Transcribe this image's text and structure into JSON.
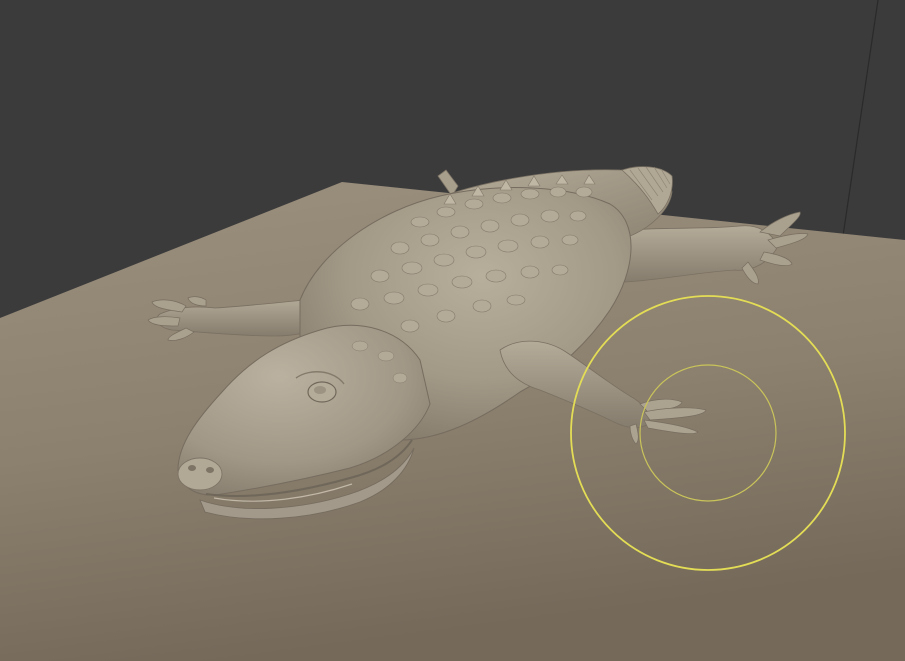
{
  "viewport": {
    "background_color": "#3a3a3a",
    "floor_color": "#8f8270",
    "floor_shadow_color": "#7b705f",
    "model_color": "#a59b89",
    "model_light_color": "#bdb3a1",
    "model_dark_color": "#766d60",
    "brush_color": "#e6e05a"
  },
  "scene": {
    "floor": "sculpt-floor-plane",
    "model": "alligator-sculpt",
    "cursor": "brush-cursor-icon"
  }
}
